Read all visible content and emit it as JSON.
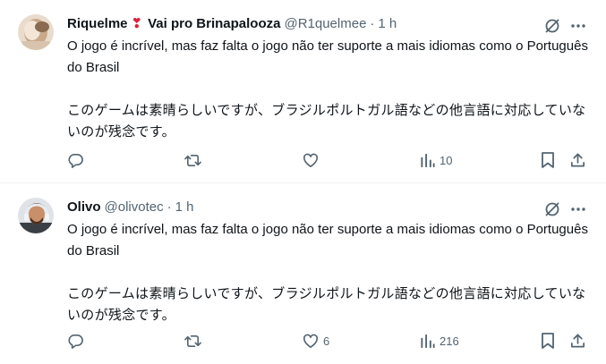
{
  "posts": [
    {
      "display_name": "Riquelme",
      "name_suffix": "Vai pro Brinapalooza",
      "name_emoji": "❣",
      "handle": "@R1quelmee",
      "time": "1 h",
      "text_pt": "O jogo é incrível, mas faz falta o jogo não ter suporte a mais idiomas como o Português do Brasil",
      "text_jp": "このゲームは素晴らしいですが、ブラジルポルトガル語などの他言語に対応していないのが残念です。",
      "replies": "",
      "reposts": "",
      "likes": "",
      "views": "10"
    },
    {
      "display_name": "Olivo",
      "name_suffix": "",
      "name_emoji": "",
      "handle": "@olivotec",
      "time": "1 h",
      "text_pt": "O jogo é incrível, mas faz falta o jogo não ter suporte a mais idiomas como o Português do Brasil",
      "text_jp": "このゲームは素晴らしいですが、ブラジルポルトガル語などの他言語に対応していないのが残念です。",
      "replies": "",
      "reposts": "",
      "likes": "6",
      "views": "216"
    }
  ],
  "separator": "·",
  "colors": {
    "text": "#0f1419",
    "secondary": "#536471",
    "divider": "#eff3f4",
    "emoji_heart": "#dd1e3d"
  },
  "icons": [
    "grok-icon",
    "more-icon",
    "reply-icon",
    "repost-icon",
    "like-icon",
    "views-icon",
    "bookmark-icon",
    "share-icon"
  ]
}
